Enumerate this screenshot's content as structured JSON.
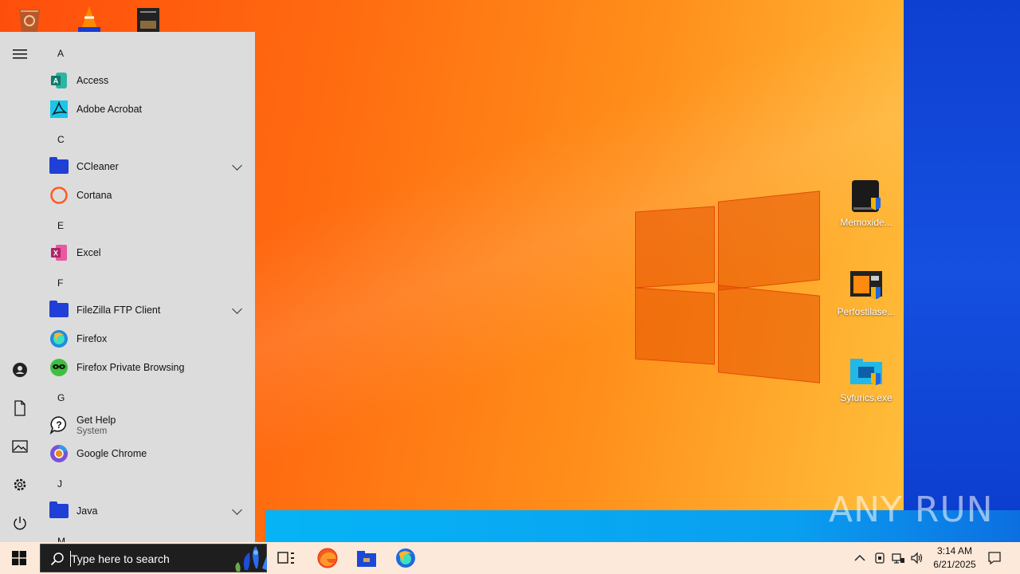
{
  "start_menu": {
    "sections": [
      {
        "letter": "A",
        "apps": [
          {
            "label": "Access"
          },
          {
            "label": "Adobe Acrobat"
          }
        ]
      },
      {
        "letter": "C",
        "apps": [
          {
            "label": "CCleaner"
          },
          {
            "label": "Cortana"
          }
        ]
      },
      {
        "letter": "E",
        "apps": [
          {
            "label": "Excel"
          }
        ]
      },
      {
        "letter": "F",
        "apps": [
          {
            "label": "FileZilla FTP Client"
          },
          {
            "label": "Firefox"
          },
          {
            "label": "Firefox Private Browsing"
          }
        ]
      },
      {
        "letter": "G",
        "apps": [
          {
            "label": "Get Help",
            "sub": "System"
          },
          {
            "label": "Google Chrome"
          }
        ]
      },
      {
        "letter": "J",
        "apps": [
          {
            "label": "Java"
          }
        ]
      },
      {
        "letter": "M",
        "apps": []
      }
    ]
  },
  "desktop": {
    "icons": [
      {
        "label": "Memoxide..."
      },
      {
        "label": "Perfostilase..."
      },
      {
        "label": "Syfurics.exe"
      }
    ],
    "watermark": "ANY RUN"
  },
  "taskbar": {
    "search_placeholder": "Type here to search",
    "clock_time": "3:14 AM",
    "clock_date": "6/21/2025"
  }
}
